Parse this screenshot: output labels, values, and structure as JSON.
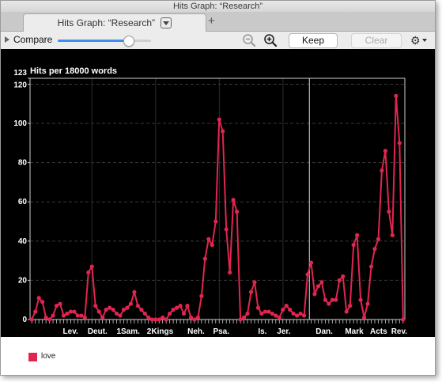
{
  "window": {
    "title": "Hits Graph: “Research”",
    "tab_title": "Hits Graph: “Research”",
    "new_tab_icon": "plus-icon"
  },
  "toolbar": {
    "compare_label": "Compare",
    "compare_slider_level": 0.75,
    "keep_label": "Keep",
    "clear_label": "Clear",
    "gear_icon": "gear-icon",
    "zoom_out_icon": "zoom-out-icon",
    "zoom_in_icon": "zoom-in-icon"
  },
  "legend": {
    "label": "love",
    "color": "#e0264f"
  },
  "chart_data": {
    "type": "line",
    "title": "Hits per 18000 words",
    "xlabel": "",
    "ylabel": "",
    "ylim": [
      0,
      123
    ],
    "y_ticks": [
      0,
      20,
      40,
      60,
      80,
      100,
      120,
      123
    ],
    "x_tick_labels": [
      "Lev.",
      "Deut.",
      "1Sam.",
      "2Kings",
      "Neh.",
      "Psa.",
      "Is.",
      "Jer.",
      "Dan.",
      "Mark",
      "Acts",
      "Rev."
    ],
    "grid": true,
    "line_color": "#e0264f",
    "series": [
      {
        "name": "love",
        "values": [
          0,
          4,
          11,
          9,
          1,
          0,
          2,
          7,
          8,
          2,
          3,
          4,
          4,
          2,
          2,
          1,
          24,
          27,
          7,
          4,
          1,
          5,
          6,
          5,
          3,
          2,
          5,
          6,
          8,
          14,
          7,
          5,
          3,
          1,
          0,
          0,
          0,
          1,
          0,
          3,
          5,
          6,
          7,
          3,
          7,
          1,
          0,
          1,
          12,
          31,
          41,
          38,
          50,
          102,
          96,
          46,
          24,
          61,
          55,
          0,
          1,
          3,
          14,
          19,
          6,
          3,
          4,
          4,
          3,
          2,
          1,
          5,
          7,
          5,
          3,
          2,
          3,
          2,
          23,
          29,
          13,
          17,
          19,
          10,
          8,
          10,
          10,
          20,
          22,
          4,
          7,
          38,
          43,
          10,
          1,
          8,
          27,
          36,
          41,
          76,
          86,
          55,
          43,
          114,
          90,
          0
        ]
      }
    ]
  }
}
